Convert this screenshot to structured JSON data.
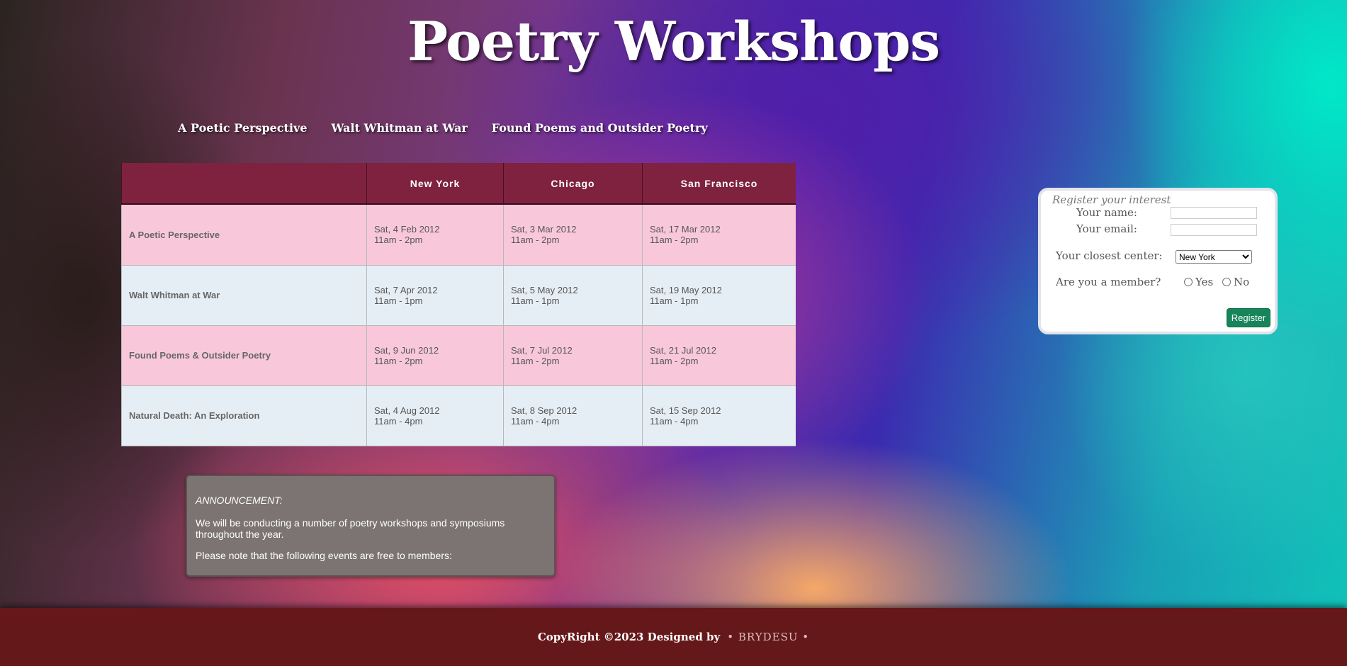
{
  "header": {
    "title": "Poetry Workshops"
  },
  "nav": {
    "items": [
      {
        "label": "A Poetic Perspective"
      },
      {
        "label": "Walt Whitman at War"
      },
      {
        "label": "Found Poems and Outsider Poetry"
      }
    ]
  },
  "schedule": {
    "columns": [
      "",
      "New York",
      "Chicago",
      "San Francisco"
    ],
    "rows": [
      {
        "name": "A Poetic Perspective",
        "cells": [
          {
            "date": "Sat, 4 Feb 2012",
            "time": "11am - 2pm"
          },
          {
            "date": "Sat, 3 Mar 2012",
            "time": "11am - 2pm"
          },
          {
            "date": "Sat, 17 Mar 2012",
            "time": "11am - 2pm"
          }
        ]
      },
      {
        "name": "Walt Whitman at War",
        "cells": [
          {
            "date": "Sat, 7 Apr 2012",
            "time": "11am - 1pm"
          },
          {
            "date": "Sat, 5 May 2012",
            "time": "11am - 1pm"
          },
          {
            "date": "Sat, 19 May 2012",
            "time": "11am - 1pm"
          }
        ]
      },
      {
        "name": "Found Poems & Outsider Poetry",
        "cells": [
          {
            "date": "Sat, 9 Jun 2012",
            "time": "11am - 2pm"
          },
          {
            "date": "Sat, 7 Jul 2012",
            "time": "11am - 2pm"
          },
          {
            "date": "Sat, 21 Jul 2012",
            "time": "11am - 2pm"
          }
        ]
      },
      {
        "name": "Natural Death: An Exploration",
        "cells": [
          {
            "date": "Sat, 4 Aug 2012",
            "time": "11am - 4pm"
          },
          {
            "date": "Sat, 8 Sep 2012",
            "time": "11am - 4pm"
          },
          {
            "date": "Sat, 15 Sep 2012",
            "time": "11am - 4pm"
          }
        ]
      }
    ]
  },
  "announcement": {
    "heading": "ANNOUNCEMENT:",
    "paragraphs": [
      "We will be conducting a number of poetry workshops and symposiums throughout the year.",
      "Please note that the following events are free to members:"
    ]
  },
  "register": {
    "legend": "Register your interest",
    "name_label": "Your name:",
    "name_value": "",
    "email_label": "Your email:",
    "email_value": "",
    "center_label": "Your closest center:",
    "center_selected": "New York",
    "member_label": "Are you a member?",
    "member_yes": "Yes",
    "member_no": "No",
    "button_label": "Register"
  },
  "footer": {
    "copyright": "CopyRight ©2023 Designed by",
    "brand": "• BRYDESU •"
  },
  "colors": {
    "table_header": "#7e2240",
    "row_pink": "#f8c8da",
    "row_blue": "#e6eef5",
    "footer_bg": "#651819",
    "register_button": "#17855a"
  }
}
